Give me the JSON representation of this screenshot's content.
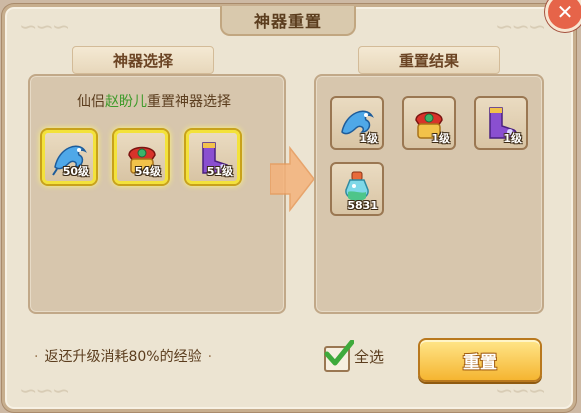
{
  "window": {
    "title": "神器重置"
  },
  "left_panel": {
    "header": "神器选择",
    "caption_prefix": "仙侣",
    "caption_name": "赵盼儿",
    "caption_suffix": "重置神器选择",
    "items": [
      {
        "icon": "blue-dragon-icon",
        "level": "50级",
        "selected": true
      },
      {
        "icon": "red-gold-charm-icon",
        "level": "54级",
        "selected": true
      },
      {
        "icon": "purple-boot-icon",
        "level": "51级",
        "selected": true
      }
    ]
  },
  "right_panel": {
    "header": "重置结果",
    "items": [
      {
        "icon": "blue-dragon-icon",
        "label": "1级"
      },
      {
        "icon": "red-gold-charm-icon",
        "label": "1级"
      },
      {
        "icon": "purple-boot-icon",
        "label": "1级"
      },
      {
        "icon": "exp-potion-icon",
        "label": "5831"
      }
    ]
  },
  "bottom": {
    "note": "返还升级消耗80%的经验",
    "note_bullet": "·",
    "select_all_label": "全选",
    "select_all_checked": true,
    "reset_button": "重置"
  },
  "colors": {
    "accent_gold": "#f5b531",
    "highlight_green": "#3f9b2c",
    "close_red": "#e66449"
  }
}
